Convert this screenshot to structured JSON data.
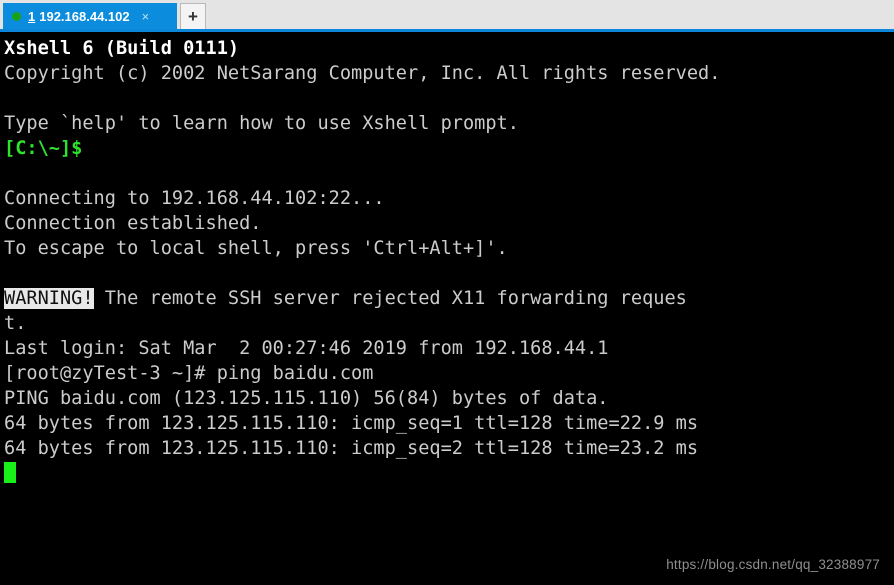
{
  "window": {
    "app_name": "Xshell 6",
    "colors": {
      "tab_active": "#0b8cdc",
      "tabbar_background": "#e4e4e4",
      "tabbar_underline": "#0b86d8",
      "terminal_background": "#000000",
      "terminal_foreground": "#cccccc",
      "prompt_green": "#2fe02f",
      "cursor_green": "#19ef19",
      "status_dot_green": "#17a317"
    }
  },
  "tabbar": {
    "tabs": [
      {
        "status_icon": "green-dot-icon",
        "index": "1",
        "title": "192.168.44.102",
        "close_label": "×"
      }
    ],
    "new_tab_label": "+"
  },
  "terminal": {
    "lines": [
      {
        "id": "l01",
        "segments": [
          {
            "style": "bold-white",
            "text": "Xshell 6 (Build 0111)"
          }
        ]
      },
      {
        "id": "l02",
        "segments": [
          {
            "style": "white",
            "text": "Copyright (c) 2002 NetSarang Computer, Inc. All rights reserved."
          }
        ]
      },
      {
        "id": "l03",
        "segments": [
          {
            "style": "white",
            "text": ""
          }
        ]
      },
      {
        "id": "l04",
        "segments": [
          {
            "style": "white",
            "text": "Type `help' to learn how to use Xshell prompt."
          }
        ]
      },
      {
        "id": "l05",
        "segments": [
          {
            "style": "green",
            "text": "[C:\\~]$"
          }
        ]
      },
      {
        "id": "l06",
        "segments": [
          {
            "style": "white",
            "text": ""
          }
        ]
      },
      {
        "id": "l07",
        "segments": [
          {
            "style": "white",
            "text": "Connecting to 192.168.44.102:22..."
          }
        ]
      },
      {
        "id": "l08",
        "segments": [
          {
            "style": "white",
            "text": "Connection established."
          }
        ]
      },
      {
        "id": "l09",
        "segments": [
          {
            "style": "white",
            "text": "To escape to local shell, press 'Ctrl+Alt+]'."
          }
        ]
      },
      {
        "id": "l10",
        "segments": [
          {
            "style": "white",
            "text": ""
          }
        ]
      },
      {
        "id": "l11",
        "segments": [
          {
            "style": "inverse",
            "text": "WARNING!"
          },
          {
            "style": "white",
            "text": " The remote SSH server rejected X11 forwarding reques"
          }
        ]
      },
      {
        "id": "l12",
        "segments": [
          {
            "style": "white",
            "text": "t."
          }
        ]
      },
      {
        "id": "l13",
        "segments": [
          {
            "style": "white",
            "text": "Last login: Sat Mar  2 00:27:46 2019 from 192.168.44.1"
          }
        ]
      },
      {
        "id": "l14",
        "segments": [
          {
            "style": "white",
            "text": "[root@zyTest-3 ~]# ping baidu.com"
          }
        ]
      },
      {
        "id": "l15",
        "segments": [
          {
            "style": "white",
            "text": "PING baidu.com (123.125.115.110) 56(84) bytes of data."
          }
        ]
      },
      {
        "id": "l16",
        "segments": [
          {
            "style": "white",
            "text": "64 bytes from 123.125.115.110: icmp_seq=1 ttl=128 time=22.9 ms"
          }
        ]
      },
      {
        "id": "l17",
        "segments": [
          {
            "style": "white",
            "text": "64 bytes from 123.125.115.110: icmp_seq=2 ttl=128 time=23.2 ms"
          }
        ]
      },
      {
        "id": "l18",
        "segments": [
          {
            "style": "cursor",
            "text": ""
          }
        ]
      }
    ],
    "session": {
      "host": "192.168.44.102",
      "port": "22",
      "hostname": "zyTest-3",
      "user": "root",
      "command": "ping baidu.com",
      "ping_target": "baidu.com",
      "ping_ip": "123.125.115.110",
      "ping_payload_bytes": "56(84)",
      "replies": [
        {
          "bytes": "64",
          "from": "123.125.115.110",
          "icmp_seq": "1",
          "ttl": "128",
          "time": "22.9 ms"
        },
        {
          "bytes": "64",
          "from": "123.125.115.110",
          "icmp_seq": "2",
          "ttl": "128",
          "time": "23.2 ms"
        }
      ]
    }
  },
  "watermark": {
    "text": "https://blog.csdn.net/qq_32388977"
  }
}
